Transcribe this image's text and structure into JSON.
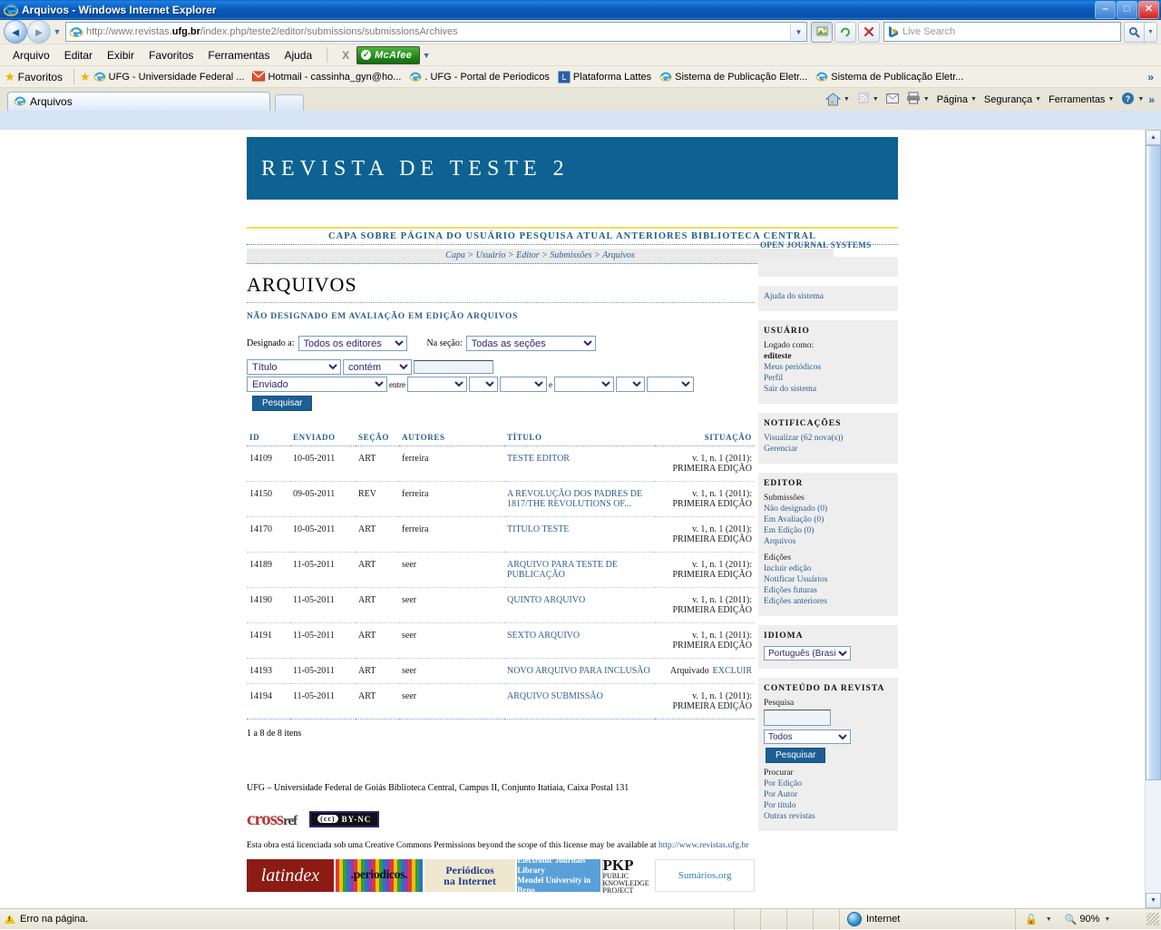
{
  "window": {
    "title": "Arquivos - Windows Internet Explorer",
    "minimize": "–",
    "maximize": "□",
    "close": "✕"
  },
  "browser": {
    "back_icon": "◄",
    "forward_icon": "►",
    "history_caret": "▼",
    "url_prefix": "http://www.revistas.",
    "url_bold": "ufg.br",
    "url_suffix": "/index.php/teste2/editor/submissions/submissionsArchives",
    "url_full": "http://www.revistas.ufg.br/index.php/teste2/editor/submissions/submissionsArchives",
    "compat_icon": "⛰",
    "refresh_icon": "↻",
    "stop_icon": "✕",
    "search_placeholder": "Live Search",
    "search_go_icon": "🔍",
    "menu": [
      "Arquivo",
      "Editar",
      "Exibir",
      "Favoritos",
      "Ferramentas",
      "Ajuda"
    ],
    "mcafee_label": "McAfee",
    "mcafee_close": "X",
    "favorites_label": "Favoritos",
    "favorites": [
      "UFG - Universidade Federal ...",
      "Hotmail - cassinha_gyn@ho...",
      ". UFG - Portal de Periodicos",
      "Plataforma Lattes",
      "Sistema de Publicação Eletr...",
      "Sistema de Publicação Eletr..."
    ],
    "overflow_icon": "»",
    "tab_label": "Arquivos",
    "command_bar": [
      {
        "label": "",
        "icon": "home",
        "caret": true
      },
      {
        "label": "",
        "icon": "feed",
        "caret": true
      },
      {
        "label": "",
        "icon": "mail",
        "caret": false
      },
      {
        "label": "",
        "icon": "print",
        "caret": true
      },
      {
        "label": "Página",
        "icon": "",
        "caret": true
      },
      {
        "label": "Segurança",
        "icon": "",
        "caret": true
      },
      {
        "label": "Ferramentas",
        "icon": "",
        "caret": true
      },
      {
        "label": "",
        "icon": "help",
        "caret": true
      }
    ]
  },
  "statusbar": {
    "error_text": "Erro na página.",
    "zone": "Internet",
    "zoom": "90%",
    "caret": "▼"
  },
  "page": {
    "journal_title": "REVISTA DE TESTE 2",
    "nav_menu": "CAPA SOBRE PÁGINA DO USUÁRIO PESQUISA ATUAL ANTERIORES BIBLIOTECA CENTRAL",
    "ojs_badge": "OPEN JOURNAL SYSTEMS",
    "breadcrumb": "Capa > Usuário > Editor > Submissões > Arquivos",
    "title": "ARQUIVOS",
    "subnav": "NÃO DESIGNADO EM AVALIAÇÃO EM EDIÇÃO ARQUIVOS",
    "filters": {
      "assigned_label": "Designado a:",
      "assigned_value": "Todos os editores",
      "section_label": "Na seção:",
      "section_value": "Todas as seções",
      "field_value": "Título",
      "operator_value": "contém",
      "text_value": "",
      "date_field_value": "Enviado",
      "between_label": "entre",
      "and_label": "e",
      "date_parts": [
        "",
        "",
        "",
        "",
        "",
        ""
      ],
      "search_button": "Pesquisar"
    },
    "table": {
      "headers": [
        "ID",
        "ENVIADO",
        "SEÇÃO",
        "AUTORES",
        "TÍTULO",
        "SITUAÇÃO"
      ],
      "rows": [
        {
          "id": "14109",
          "enviado": "10-05-2011",
          "secao": "ART",
          "autores": "ferreira",
          "titulo": "TESTE EDITOR",
          "situacao": "v. 1, n. 1 (2011): PRIMEIRA EDIÇÃO",
          "action": ""
        },
        {
          "id": "14150",
          "enviado": "09-05-2011",
          "secao": "REV",
          "autores": "ferreira",
          "titulo": "A REVOLUÇÃO DOS PADRES DE 1817/THE REVOLUTIONS OF...",
          "situacao": "v. 1, n. 1 (2011): PRIMEIRA EDIÇÃO",
          "action": ""
        },
        {
          "id": "14170",
          "enviado": "10-05-2011",
          "secao": "ART",
          "autores": "ferreira",
          "titulo": "TITULO TESTE",
          "situacao": "v. 1, n. 1 (2011): PRIMEIRA EDIÇÃO",
          "action": ""
        },
        {
          "id": "14189",
          "enviado": "11-05-2011",
          "secao": "ART",
          "autores": "seer",
          "titulo": "ARQUIVO PARA TESTE DE PUBLICAÇÃO",
          "situacao": "v. 1, n. 1 (2011): PRIMEIRA EDIÇÃO",
          "action": ""
        },
        {
          "id": "14190",
          "enviado": "11-05-2011",
          "secao": "ART",
          "autores": "seer",
          "titulo": "QUINTO ARQUIVO",
          "situacao": "v. 1, n. 1 (2011): PRIMEIRA EDIÇÃO",
          "action": ""
        },
        {
          "id": "14191",
          "enviado": "11-05-2011",
          "secao": "ART",
          "autores": "seer",
          "titulo": "SEXTO ARQUIVO",
          "situacao": "v. 1, n. 1 (2011): PRIMEIRA EDIÇÃO",
          "action": ""
        },
        {
          "id": "14193",
          "enviado": "11-05-2011",
          "secao": "ART",
          "autores": "seer",
          "titulo": "NOVO ARQUIVO PARA INCLUSÃO",
          "situacao": "Arquivado",
          "action": "EXCLUIR"
        },
        {
          "id": "14194",
          "enviado": "11-05-2011",
          "secao": "ART",
          "autores": "seer",
          "titulo": "ARQUIVO SUBMISSÃO",
          "situacao": "v. 1, n. 1 (2011): PRIMEIRA EDIÇÃO",
          "action": ""
        }
      ],
      "count": "1 a 8 de 8 itens"
    },
    "footer": {
      "address": "UFG – Universidade Federal de Goiás Biblioteca Central, Campus II, Conjunto Itatiaia, Caixa Postal 131",
      "crossref": "cross",
      "crossref_ref": "ref",
      "cc_cc": "(cc)",
      "cc_by": "BY-NC",
      "license_text": "Esta obra está licenciada sob uma Creative Commons Permissions beyond the scope of this license may be available at ",
      "license_link": "http://www.revistas.ufg.br",
      "badges": [
        {
          "name": "latindex",
          "text": "latindex"
        },
        {
          "name": "periodicos",
          "text": ".periodicos."
        },
        {
          "name": "periodicos-na-internet",
          "line1": "Periódicos",
          "line2": "na Internet"
        },
        {
          "name": "electronic-journals-library",
          "line1": "Electronic Journals Library",
          "line2": "Mendel University in Brno"
        },
        {
          "name": "pkp",
          "big": "PKP",
          "line1": "PUBLIC",
          "line2": "KNOWLEDGE",
          "line3": "PROJECT"
        },
        {
          "name": "sumarios",
          "text": "Sumários.org"
        }
      ]
    },
    "sidebar": {
      "help_link": "Ajuda do sistema",
      "user": {
        "title": "USUÁRIO",
        "logged_label": "Logado como:",
        "username": "editeste",
        "links": [
          "Meus periódicos",
          "Perfil",
          "Sair do sistema"
        ]
      },
      "notifications": {
        "title": "NOTIFICAÇÕES",
        "links": [
          "Visualizar (62 nova(s))",
          "Gerenciar"
        ]
      },
      "editor": {
        "title": "EDITOR",
        "submissions_label": "Submissões",
        "submission_links": [
          "Não designado (0)",
          "Em Avaliação (0)",
          "Em Edição (0)",
          "Arquivos"
        ],
        "issues_label": "Edições",
        "issue_links": [
          "Incluir edição",
          "Notificar Usuários",
          "Edições futuras",
          "Edições anteriores"
        ]
      },
      "language": {
        "title": "IDIOMA",
        "value": "Português (Brasil)"
      },
      "journal_content": {
        "title": "CONTEÚDO DA REVISTA",
        "search_label": "Pesquisa",
        "search_value": "",
        "scope_value": "Todos",
        "search_button": "Pesquisar",
        "browse_label": "Procurar",
        "browse_links": [
          "Por Edição",
          "Por Autor",
          "Por título",
          "Outras revistas"
        ]
      }
    }
  }
}
